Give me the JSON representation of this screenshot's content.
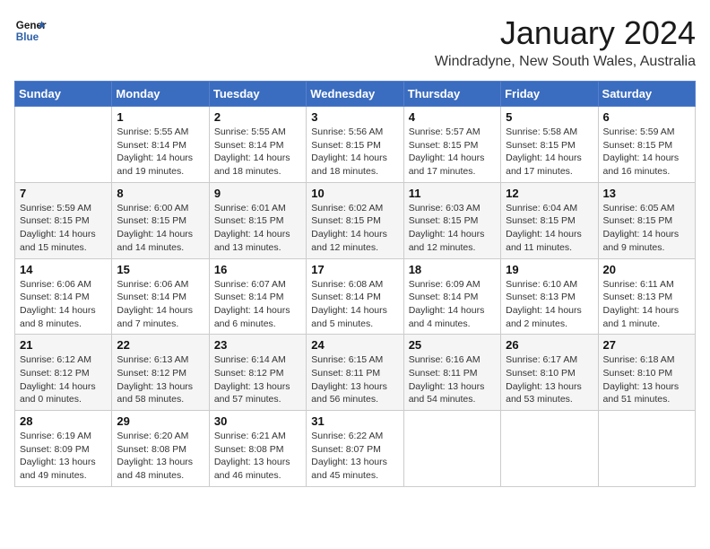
{
  "logo": {
    "line1": "General",
    "line2": "Blue"
  },
  "header": {
    "month": "January 2024",
    "location": "Windradyne, New South Wales, Australia"
  },
  "weekdays": [
    "Sunday",
    "Monday",
    "Tuesday",
    "Wednesday",
    "Thursday",
    "Friday",
    "Saturday"
  ],
  "weeks": [
    [
      {
        "day": "",
        "info": ""
      },
      {
        "day": "1",
        "info": "Sunrise: 5:55 AM\nSunset: 8:14 PM\nDaylight: 14 hours\nand 19 minutes."
      },
      {
        "day": "2",
        "info": "Sunrise: 5:55 AM\nSunset: 8:14 PM\nDaylight: 14 hours\nand 18 minutes."
      },
      {
        "day": "3",
        "info": "Sunrise: 5:56 AM\nSunset: 8:15 PM\nDaylight: 14 hours\nand 18 minutes."
      },
      {
        "day": "4",
        "info": "Sunrise: 5:57 AM\nSunset: 8:15 PM\nDaylight: 14 hours\nand 17 minutes."
      },
      {
        "day": "5",
        "info": "Sunrise: 5:58 AM\nSunset: 8:15 PM\nDaylight: 14 hours\nand 17 minutes."
      },
      {
        "day": "6",
        "info": "Sunrise: 5:59 AM\nSunset: 8:15 PM\nDaylight: 14 hours\nand 16 minutes."
      }
    ],
    [
      {
        "day": "7",
        "info": "Sunrise: 5:59 AM\nSunset: 8:15 PM\nDaylight: 14 hours\nand 15 minutes."
      },
      {
        "day": "8",
        "info": "Sunrise: 6:00 AM\nSunset: 8:15 PM\nDaylight: 14 hours\nand 14 minutes."
      },
      {
        "day": "9",
        "info": "Sunrise: 6:01 AM\nSunset: 8:15 PM\nDaylight: 14 hours\nand 13 minutes."
      },
      {
        "day": "10",
        "info": "Sunrise: 6:02 AM\nSunset: 8:15 PM\nDaylight: 14 hours\nand 12 minutes."
      },
      {
        "day": "11",
        "info": "Sunrise: 6:03 AM\nSunset: 8:15 PM\nDaylight: 14 hours\nand 12 minutes."
      },
      {
        "day": "12",
        "info": "Sunrise: 6:04 AM\nSunset: 8:15 PM\nDaylight: 14 hours\nand 11 minutes."
      },
      {
        "day": "13",
        "info": "Sunrise: 6:05 AM\nSunset: 8:15 PM\nDaylight: 14 hours\nand 9 minutes."
      }
    ],
    [
      {
        "day": "14",
        "info": "Sunrise: 6:06 AM\nSunset: 8:14 PM\nDaylight: 14 hours\nand 8 minutes."
      },
      {
        "day": "15",
        "info": "Sunrise: 6:06 AM\nSunset: 8:14 PM\nDaylight: 14 hours\nand 7 minutes."
      },
      {
        "day": "16",
        "info": "Sunrise: 6:07 AM\nSunset: 8:14 PM\nDaylight: 14 hours\nand 6 minutes."
      },
      {
        "day": "17",
        "info": "Sunrise: 6:08 AM\nSunset: 8:14 PM\nDaylight: 14 hours\nand 5 minutes."
      },
      {
        "day": "18",
        "info": "Sunrise: 6:09 AM\nSunset: 8:14 PM\nDaylight: 14 hours\nand 4 minutes."
      },
      {
        "day": "19",
        "info": "Sunrise: 6:10 AM\nSunset: 8:13 PM\nDaylight: 14 hours\nand 2 minutes."
      },
      {
        "day": "20",
        "info": "Sunrise: 6:11 AM\nSunset: 8:13 PM\nDaylight: 14 hours\nand 1 minute."
      }
    ],
    [
      {
        "day": "21",
        "info": "Sunrise: 6:12 AM\nSunset: 8:12 PM\nDaylight: 14 hours\nand 0 minutes."
      },
      {
        "day": "22",
        "info": "Sunrise: 6:13 AM\nSunset: 8:12 PM\nDaylight: 13 hours\nand 58 minutes."
      },
      {
        "day": "23",
        "info": "Sunrise: 6:14 AM\nSunset: 8:12 PM\nDaylight: 13 hours\nand 57 minutes."
      },
      {
        "day": "24",
        "info": "Sunrise: 6:15 AM\nSunset: 8:11 PM\nDaylight: 13 hours\nand 56 minutes."
      },
      {
        "day": "25",
        "info": "Sunrise: 6:16 AM\nSunset: 8:11 PM\nDaylight: 13 hours\nand 54 minutes."
      },
      {
        "day": "26",
        "info": "Sunrise: 6:17 AM\nSunset: 8:10 PM\nDaylight: 13 hours\nand 53 minutes."
      },
      {
        "day": "27",
        "info": "Sunrise: 6:18 AM\nSunset: 8:10 PM\nDaylight: 13 hours\nand 51 minutes."
      }
    ],
    [
      {
        "day": "28",
        "info": "Sunrise: 6:19 AM\nSunset: 8:09 PM\nDaylight: 13 hours\nand 49 minutes."
      },
      {
        "day": "29",
        "info": "Sunrise: 6:20 AM\nSunset: 8:08 PM\nDaylight: 13 hours\nand 48 minutes."
      },
      {
        "day": "30",
        "info": "Sunrise: 6:21 AM\nSunset: 8:08 PM\nDaylight: 13 hours\nand 46 minutes."
      },
      {
        "day": "31",
        "info": "Sunrise: 6:22 AM\nSunset: 8:07 PM\nDaylight: 13 hours\nand 45 minutes."
      },
      {
        "day": "",
        "info": ""
      },
      {
        "day": "",
        "info": ""
      },
      {
        "day": "",
        "info": ""
      }
    ]
  ]
}
